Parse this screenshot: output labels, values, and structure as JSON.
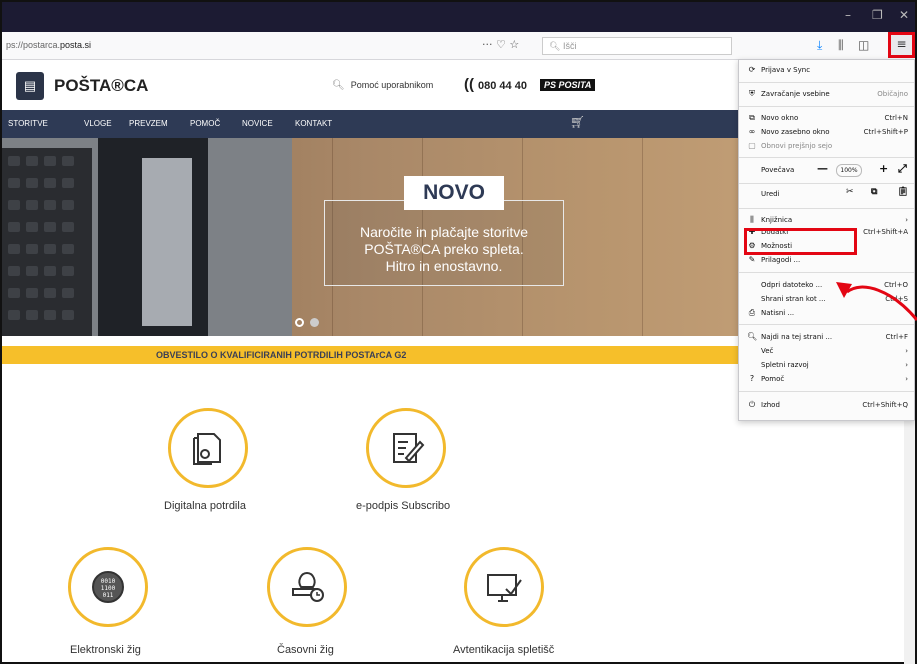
{
  "browser": {
    "window_controls": [
      "–",
      "❐",
      "✕"
    ],
    "url_prefix": "ps://postarca.",
    "url_domain": "posta.si",
    "url_actions": "··· ♡ ☆",
    "search_placeholder": "Išči",
    "toolbar_icons": [
      "download-icon",
      "library-icon",
      "sidebar-icon",
      "hamburger-menu-icon"
    ]
  },
  "site": {
    "logo_text": "POŠTA®CA",
    "help_text": "Pomoć uporabnikom",
    "phone": "080 44 40",
    "posita": "PS POSITA",
    "menu": [
      "STORITVE",
      "VLOGE",
      "PREVZEM",
      "POMOČ",
      "NOVICE",
      "KONTAKT"
    ],
    "hero": {
      "badge": "NOVO",
      "lines": [
        "Naročite in plačajte storitve",
        "POŠTA®CA preko spleta.",
        "Hitro in enostavno."
      ]
    },
    "notice": "OBVESTILO O KVALIFICIRANIH POTRDILIH POSTArCA G2",
    "features": [
      {
        "label": "Digitalna potrdila",
        "icon": "certificate-icon"
      },
      {
        "label": "e-podpis Subscribo",
        "icon": "document-sign-icon"
      },
      {
        "label": "Elektronski žig",
        "icon": "binary-seal-icon"
      },
      {
        "label": "Časovni žig",
        "icon": "time-stamp-icon"
      },
      {
        "label": "Avtentikacija spletišč",
        "icon": "monitor-check-icon"
      }
    ]
  },
  "ff_menu": {
    "sync": "Prijava v Sync",
    "tracking": "Zavračanje vsebine",
    "tracking_value": "Običajno",
    "new_window": "Novo okno",
    "new_window_sc": "Ctrl+N",
    "private_window": "Novo zasebno okno",
    "private_window_sc": "Ctrl+Shift+P",
    "restore": "Obnovi prejšnjo sejo",
    "zoom_label": "Povečava",
    "zoom_minus": "—",
    "zoom_value": "100%",
    "zoom_plus": "+",
    "edit_label": "Uredi",
    "library": "Knjižnica",
    "addons": "Dodatki",
    "addons_sc": "Ctrl+Shift+A",
    "options": "Možnosti",
    "customize": "Prilagodi ...",
    "open_file": "Odpri datoteko ...",
    "open_file_sc": "Ctrl+O",
    "save_page": "Shrani stran kot ...",
    "save_page_sc": "Ctrl+S",
    "print": "Natisni ...",
    "find": "Najdi na tej strani ...",
    "find_sc": "Ctrl+F",
    "more": "Več",
    "webdev": "Spletni razvoj",
    "help": "Pomoč",
    "exit": "Izhod",
    "exit_sc": "Ctrl+Shift+Q",
    "chevron": "›"
  },
  "colors": {
    "accent": "#f6bf2a",
    "nav": "#2e3a55",
    "highlight": "#e30613"
  }
}
